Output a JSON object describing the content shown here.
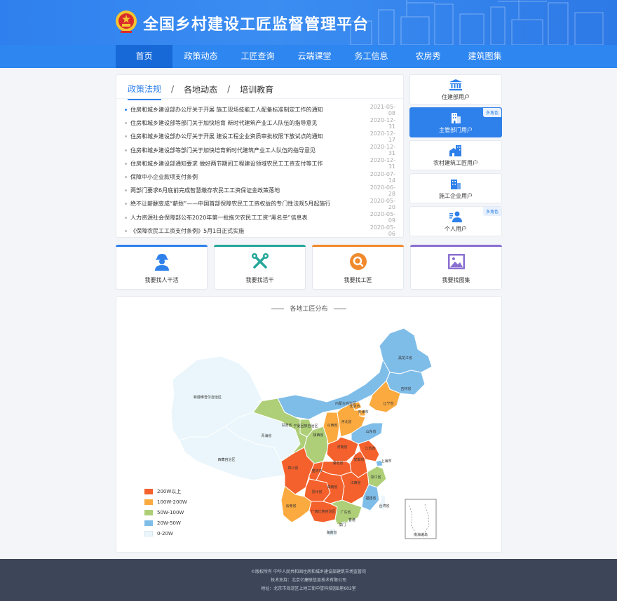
{
  "header": {
    "title": "全国乡村建设工匠监督管理平台"
  },
  "nav": {
    "items": [
      {
        "label": "首页"
      },
      {
        "label": "政策动态"
      },
      {
        "label": "工匠查询"
      },
      {
        "label": "云端课堂"
      },
      {
        "label": "务工信息"
      },
      {
        "label": "农房秀"
      },
      {
        "label": "建筑图集"
      }
    ]
  },
  "news": {
    "tabs": [
      {
        "label": "政策法规"
      },
      {
        "label": "各地动态"
      },
      {
        "label": "培训教育"
      }
    ],
    "separator": "/",
    "items": [
      {
        "title": "住房和城乡建设部办公厅关于开展 施工现场技能工人配备标准制定工作的通知",
        "date": "2021-05-08"
      },
      {
        "title": "住房和城乡建设部等部门关于加快培育 新时代建筑产业工人队伍的指导意见",
        "date": "2020-12-31"
      },
      {
        "title": "住房和城乡建设部办公厅关于开展 建设工程企业资质审批权限下放试点的通知",
        "date": "2020-12-17"
      },
      {
        "title": "住房和城乡建设部等部门关于加快培育新时代建筑产业工人队伍的指导意见",
        "date": "2020-12-31"
      },
      {
        "title": "住房和城乡建设部通知要求 做好两节期间工程建设领域农民工工资支付等工作",
        "date": "2020-12-31"
      },
      {
        "title": "保障中小企业款项支付条例",
        "date": "2020-07-14"
      },
      {
        "title": "两部门要求6月底前完成智慧缴存农民工工资保证金政策落地",
        "date": "2020-06-28"
      },
      {
        "title": "绝不让薪酬变成“薪愁”——中国首部保障农民工工资权益的专门性法规5月起施行",
        "date": "2020-05-20"
      },
      {
        "title": "人力资源社会保障部公布2020年第一批拖欠农民工工资“黑名单”信息表",
        "date": "2020-05-09"
      },
      {
        "title": "《保障农民工工资支付条例》5月1日正式实施",
        "date": "2020-05-06"
      }
    ]
  },
  "users": {
    "items": [
      {
        "label": "住建部用户",
        "badge": "",
        "icon": "bank-icon"
      },
      {
        "label": "主管部门用户",
        "badge": "多角色",
        "icon": "office-building-icon"
      },
      {
        "label": "农村建筑工匠用户",
        "badge": "",
        "icon": "rural-house-icon"
      },
      {
        "label": "施工企业用户",
        "badge": "",
        "icon": "enterprise-building-icon"
      },
      {
        "label": "个人用户",
        "badge": "多角色",
        "icon": "people-icon"
      }
    ]
  },
  "quick": {
    "items": [
      {
        "label": "我要找人干活",
        "icon": "worker-icon",
        "color": "#2e80ea"
      },
      {
        "label": "我要找活干",
        "icon": "tools-icon",
        "color": "#26a69a"
      },
      {
        "label": "我要找工匠",
        "icon": "search-icon",
        "color": "#f08a2c"
      },
      {
        "label": "我要找图集",
        "icon": "image-icon",
        "color": "#8a6fd1"
      }
    ]
  },
  "map": {
    "title": "各地工匠分布",
    "legend": [
      {
        "label": "200W以上",
        "color": "#f4612c"
      },
      {
        "label": "100W-200W",
        "color": "#fbaa3f"
      },
      {
        "label": "50W-100W",
        "color": "#aecf78"
      },
      {
        "label": "20W-50W",
        "color": "#7fbde9"
      },
      {
        "label": "0-20W",
        "color": "#eaf6fb"
      }
    ],
    "provinces": [
      {
        "name": "新疆维吾尔自治区",
        "level": 4
      },
      {
        "name": "西藏自治区",
        "level": 4
      },
      {
        "name": "青海省",
        "level": 4
      },
      {
        "name": "内蒙古自治区",
        "level": 3
      },
      {
        "name": "黑龙江省",
        "level": 3
      },
      {
        "name": "吉林省",
        "level": 3
      },
      {
        "name": "辽宁省",
        "level": 1
      },
      {
        "name": "宁夏回族自治区",
        "level": 2
      },
      {
        "name": "甘肃省",
        "level": 2
      },
      {
        "name": "陕西省",
        "level": 2
      },
      {
        "name": "山西省",
        "level": 1
      },
      {
        "name": "北京市",
        "level": 1
      },
      {
        "name": "天津市",
        "level": 1
      },
      {
        "name": "河北省",
        "level": 1
      },
      {
        "name": "山东省",
        "level": 3
      },
      {
        "name": "河南省",
        "level": 0
      },
      {
        "name": "江苏省",
        "level": 0
      },
      {
        "name": "安徽省",
        "level": 0
      },
      {
        "name": "湖北省",
        "level": 0
      },
      {
        "name": "四川省",
        "level": 0
      },
      {
        "name": "重庆市",
        "level": 0
      },
      {
        "name": "上海市",
        "level": 3
      },
      {
        "name": "浙江省",
        "level": 2
      },
      {
        "name": "贵州省",
        "level": 0
      },
      {
        "name": "湖南省",
        "level": 0
      },
      {
        "name": "江西省",
        "level": 0
      },
      {
        "name": "福建省",
        "level": 3
      },
      {
        "name": "云南省",
        "level": 1
      },
      {
        "name": "广西壮族自治区",
        "level": 0
      },
      {
        "name": "广东省",
        "level": 2
      },
      {
        "name": "台湾省",
        "level": 4
      },
      {
        "name": "香港",
        "level": 4
      },
      {
        "name": "澳门",
        "level": 4
      },
      {
        "name": "海南省",
        "level": 4
      }
    ],
    "inset_label": "南海诸岛"
  },
  "footer": {
    "copyright": "©版权所有 中华人民共和国住房和城乡建设部建筑市场监管司",
    "support": "技术支持：北京亿建联信息技术有限公司",
    "address": "地址：北京市海淀区上地三街中誉科技园B座602室"
  },
  "colors": {
    "primary": "#2e80ea",
    "nav": "#2e86f0",
    "nav_active": "#1769d8",
    "footer": "#3c4658"
  }
}
